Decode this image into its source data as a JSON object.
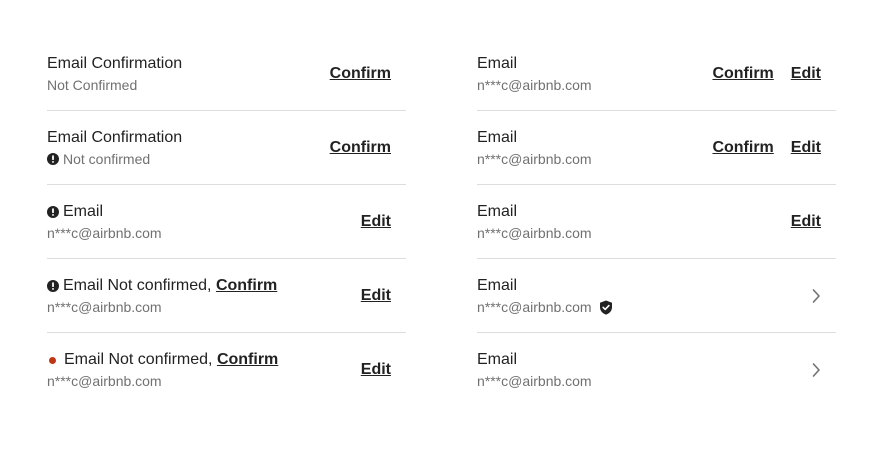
{
  "left_column": [
    {
      "title": "Email Confirmation",
      "subtitle": "Not Confirmed",
      "actions": [
        "Confirm"
      ]
    },
    {
      "title": "Email Confirmation",
      "subtitle": "Not confirmed",
      "subtitle_icon": "exclamation-circle-icon",
      "actions": [
        "Confirm"
      ]
    },
    {
      "title": "Email",
      "title_icon": "exclamation-circle-icon",
      "subtitle": "n***c@airbnb.com",
      "actions": [
        "Edit"
      ]
    },
    {
      "title": "Email Not confirmed, ",
      "title_icon": "exclamation-circle-icon",
      "title_link": "Confirm",
      "subtitle": "n***c@airbnb.com",
      "actions": [
        "Edit"
      ]
    },
    {
      "title": "Email Not confirmed, ",
      "title_icon": "red-dot-icon",
      "title_link": "Confirm",
      "subtitle": "n***c@airbnb.com",
      "actions": [
        "Edit"
      ]
    }
  ],
  "right_column": [
    {
      "title": "Email",
      "subtitle": "n***c@airbnb.com",
      "actions": [
        "Confirm",
        "Edit"
      ]
    },
    {
      "title": "Email",
      "subtitle": "n***c@airbnb.com",
      "actions": [
        "Confirm",
        "Edit"
      ]
    },
    {
      "title": "Email",
      "subtitle": "n***c@airbnb.com",
      "actions": [
        "Edit"
      ]
    },
    {
      "title": "Email",
      "subtitle": "n***c@airbnb.com",
      "subtitle_icon": "verified-shield-icon",
      "action_icon": "chevron-right-icon"
    },
    {
      "title": "Email",
      "subtitle": "n***c@airbnb.com",
      "action_icon": "chevron-right-icon"
    }
  ],
  "colors": {
    "text_primary": "#222222",
    "text_secondary": "#717171",
    "divider": "#dddddd",
    "alert_red": "#c13515"
  }
}
